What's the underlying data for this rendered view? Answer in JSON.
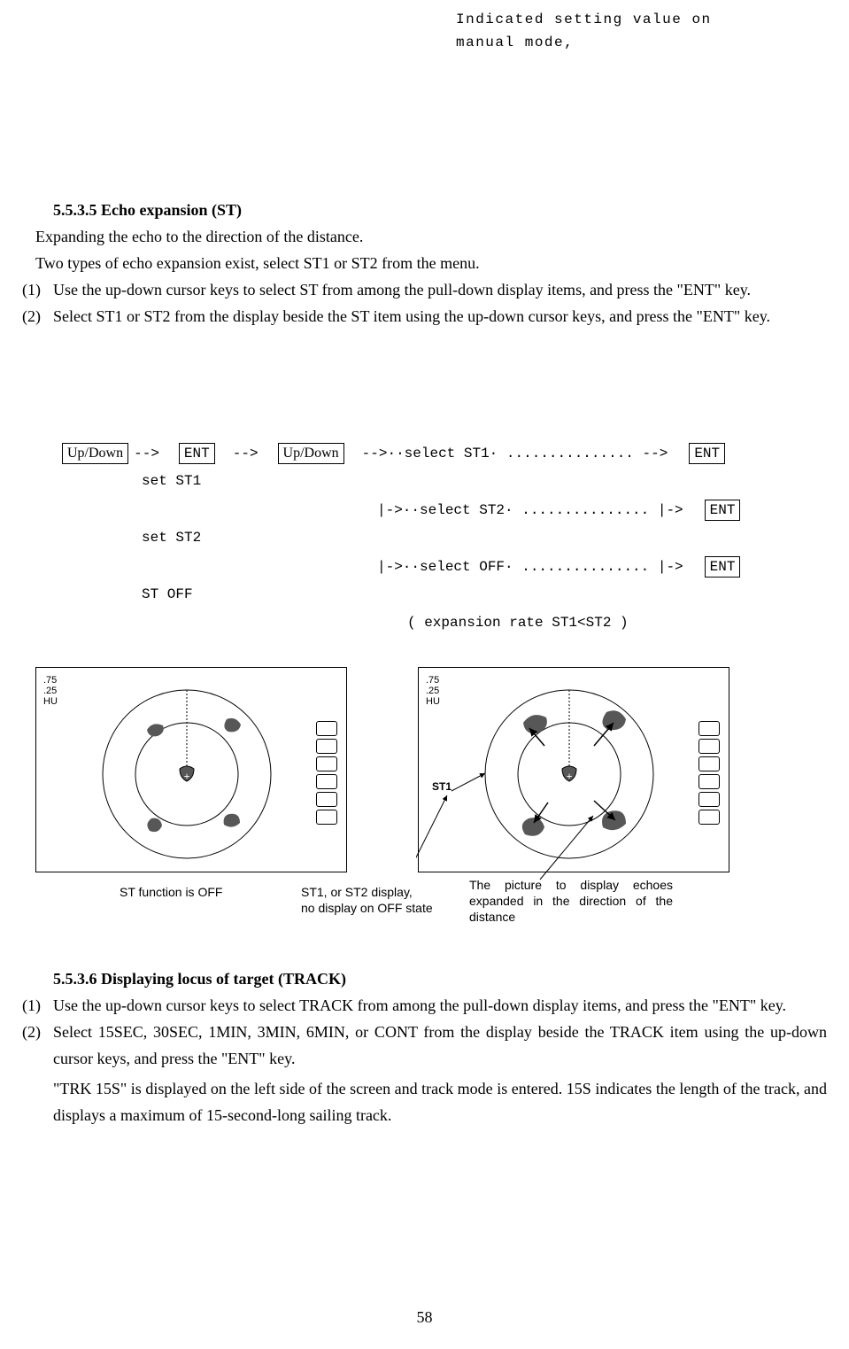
{
  "topnote": "Indicated  setting  value  on manual mode,",
  "sectionA": {
    "num_title": "5.5.3.5 Echo expansion (ST)",
    "line1": "Expanding the echo to the direction of the distance.",
    "line2": " Two types of echo expansion exist, select ST1 or ST2 from the menu.",
    "item1_marker": "(1)",
    "item1": "Use the up-down cursor keys to select ST from among the pull-down display items, and press the \"ENT\" key.",
    "item2_marker": "(2)",
    "item2": "Select ST1 or ST2 from the display beside the ST item using the up-down cursor keys, and press the \"ENT\" key."
  },
  "flow": {
    "updown": "Up/Down",
    "arr": "-->",
    "ent": "ENT",
    "sel_st1": "-->··select ST1· ............... -->",
    "set_st1": "set ST1",
    "sel_st2": "|->··select ST2· ............... |->",
    "set_st2": "set ST2",
    "sel_off": "|->··select OFF· ............... |->",
    "st_off": "ST OFF",
    "note": "( expansion rate ST1<ST2 )"
  },
  "figures": {
    "scale1": ".75",
    "scale2": ".25",
    "scale3": "HU",
    "leftCaption": "ST function is OFF",
    "midCaption": "ST1, or ST2 display,\nno display on OFF state",
    "rightCaption": "The picture to display echoes expanded in the direction of the distance",
    "st1": "ST1"
  },
  "sectionB": {
    "num_title": "5.5.3.6 Displaying locus of target (TRACK)",
    "item1_marker": "(1)",
    "item1": "Use the up-down cursor keys to select TRACK from among the pull-down display items, and press the \"ENT\" key.",
    "item2_marker": "(2)",
    "item2": "Select 15SEC, 30SEC, 1MIN, 3MIN, 6MIN, or CONT from the display beside the TRACK item using the up-down cursor keys, and press the \"ENT\" key.",
    "para3": "\"TRK 15S\" is displayed on the left side of the screen and track mode is entered.  15S indicates the length of the track, and displays a maximum of 15-second-long sailing track."
  },
  "pageNumber": "58"
}
